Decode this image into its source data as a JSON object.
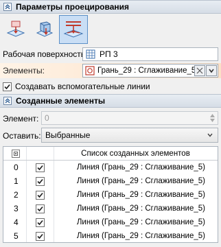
{
  "projection_section": {
    "title": "Параметры проецирования",
    "work_surface_label": "Рабочая поверхность:",
    "work_surface_value": "РП 3",
    "elements_label": "Элементы:",
    "elements_value": "Грань_29 : Сглаживание_5",
    "create_aux_lines_label": "Создавать вспомогательные линии",
    "create_aux_lines_checked": true,
    "modes": [
      {
        "icon": "project-onto-plane-icon",
        "active": false
      },
      {
        "icon": "project-cube-icon",
        "active": false
      },
      {
        "icon": "project-curves-icon",
        "active": true
      }
    ]
  },
  "created_section": {
    "title": "Созданные элементы",
    "element_label": "Элемент:",
    "element_value": "0",
    "keep_label": "Оставить:",
    "keep_value": "Выбранные",
    "table": {
      "header": "Список созданных элементов",
      "rows": [
        {
          "index": "0",
          "checked": true,
          "name": "Линия (Грань_29 : Сглаживание_5)"
        },
        {
          "index": "1",
          "checked": true,
          "name": "Линия (Грань_29 : Сглаживание_5)"
        },
        {
          "index": "2",
          "checked": true,
          "name": "Линия (Грань_29 : Сглаживание_5)"
        },
        {
          "index": "3",
          "checked": true,
          "name": "Линия (Грань_29 : Сглаживание_5)"
        },
        {
          "index": "4",
          "checked": true,
          "name": "Линия (Грань_29 : Сглаживание_5)"
        },
        {
          "index": "5",
          "checked": true,
          "name": "Линия (Грань_29 : Сглаживание_5)"
        }
      ]
    }
  }
}
